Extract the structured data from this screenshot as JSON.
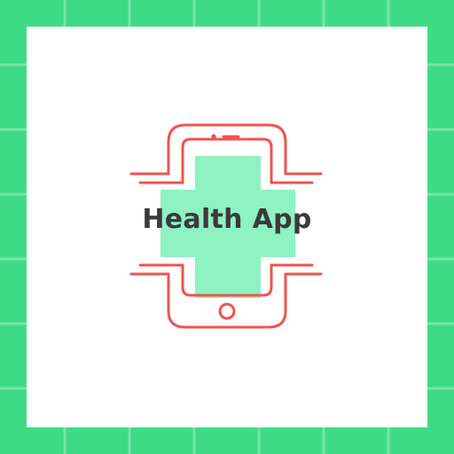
{
  "app_name": "Health App",
  "colors": {
    "border_green": "#3ddc84",
    "grid_line": "#7ee8ad",
    "card_background": "#ffffff",
    "cross_fill": "#8ef2c2",
    "phone_outline": "#ef5350",
    "title_text": "#3a3a3a"
  },
  "icons": {
    "phone": "smartphone-icon",
    "cross": "medical-cross-icon"
  }
}
